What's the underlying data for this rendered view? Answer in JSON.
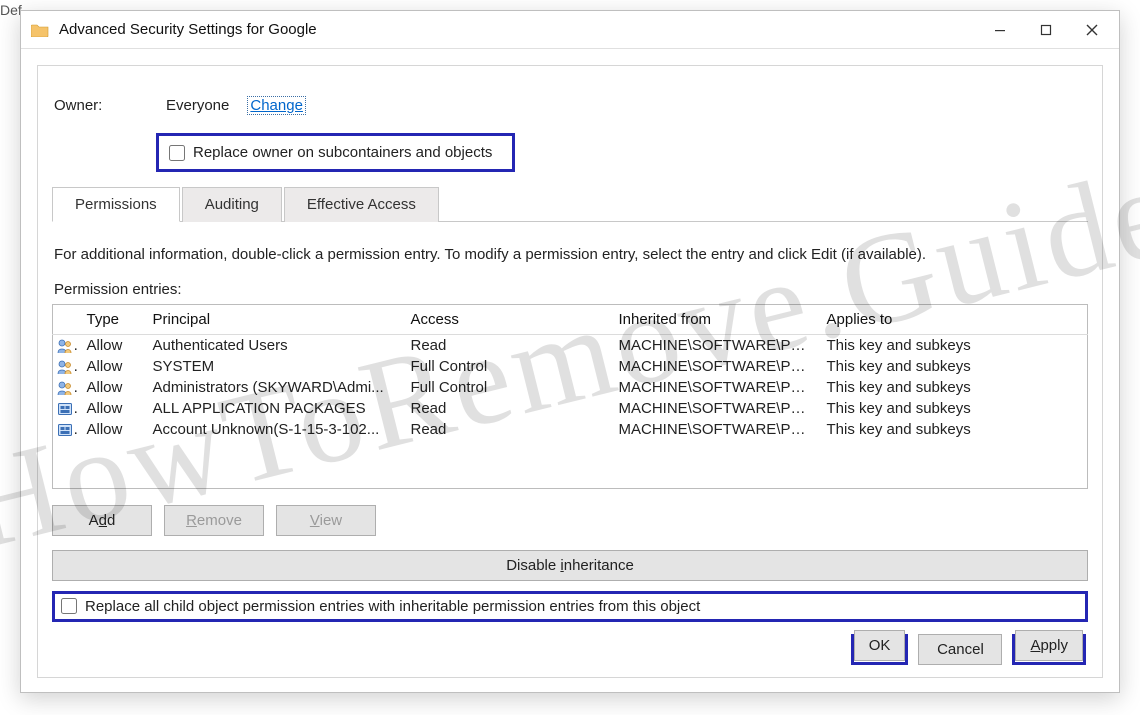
{
  "watermark": "HowToRemove.Guide",
  "window": {
    "title": "Advanced Security Settings for Google"
  },
  "owner": {
    "label": "Owner:",
    "name": "Everyone",
    "change_link": "Change"
  },
  "replace_owner": {
    "checked": false,
    "label": "Replace owner on subcontainers and objects"
  },
  "tabs": [
    {
      "label": "Permissions",
      "active": true
    },
    {
      "label": "Auditing",
      "active": false
    },
    {
      "label": "Effective Access",
      "active": false
    }
  ],
  "info_text": "For additional information, double-click a permission entry. To modify a permission entry, select the entry and click Edit (if available).",
  "entries_label": "Permission entries:",
  "columns": {
    "type": "Type",
    "principal": "Principal",
    "access": "Access",
    "inherited": "Inherited from",
    "applies": "Applies to"
  },
  "entries": [
    {
      "icon": "users",
      "type": "Allow",
      "principal": "Authenticated Users",
      "access": "Read",
      "inherited": "MACHINE\\SOFTWARE\\Po...",
      "applies": "This key and subkeys"
    },
    {
      "icon": "users",
      "type": "Allow",
      "principal": "SYSTEM",
      "access": "Full Control",
      "inherited": "MACHINE\\SOFTWARE\\Po...",
      "applies": "This key and subkeys"
    },
    {
      "icon": "users",
      "type": "Allow",
      "principal": "Administrators (SKYWARD\\Admi...",
      "access": "Full Control",
      "inherited": "MACHINE\\SOFTWARE\\Po...",
      "applies": "This key and subkeys"
    },
    {
      "icon": "package",
      "type": "Allow",
      "principal": "ALL APPLICATION PACKAGES",
      "access": "Read",
      "inherited": "MACHINE\\SOFTWARE\\Po...",
      "applies": "This key and subkeys"
    },
    {
      "icon": "package",
      "type": "Allow",
      "principal": "Account Unknown(S-1-15-3-102...",
      "access": "Read",
      "inherited": "MACHINE\\SOFTWARE\\Po...",
      "applies": "This key and subkeys"
    }
  ],
  "buttons": {
    "add": "Add",
    "remove": "Remove",
    "view": "View",
    "disable_inheritance": "Disable inheritance",
    "ok": "OK",
    "cancel": "Cancel",
    "apply": "Apply"
  },
  "replace_child": {
    "checked": false,
    "label": "Replace all child object permission entries with inheritable permission entries from this object"
  }
}
